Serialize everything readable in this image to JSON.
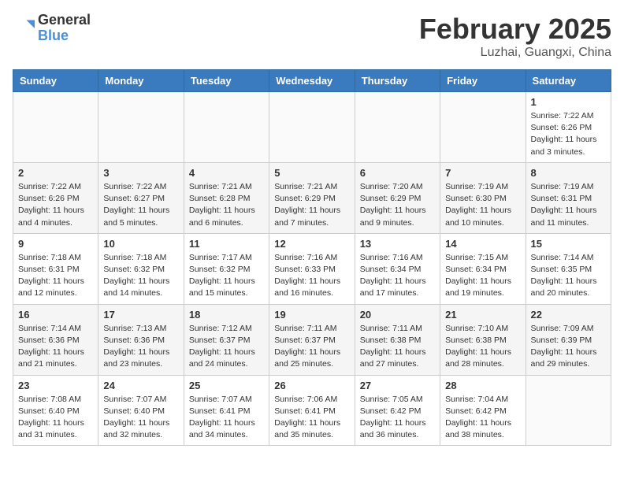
{
  "header": {
    "logo_general": "General",
    "logo_blue": "Blue",
    "month_title": "February 2025",
    "location": "Luzhai, Guangxi, China"
  },
  "weekdays": [
    "Sunday",
    "Monday",
    "Tuesday",
    "Wednesday",
    "Thursday",
    "Friday",
    "Saturday"
  ],
  "weeks": [
    [
      {
        "day": "",
        "info": ""
      },
      {
        "day": "",
        "info": ""
      },
      {
        "day": "",
        "info": ""
      },
      {
        "day": "",
        "info": ""
      },
      {
        "day": "",
        "info": ""
      },
      {
        "day": "",
        "info": ""
      },
      {
        "day": "1",
        "info": "Sunrise: 7:22 AM\nSunset: 6:26 PM\nDaylight: 11 hours\nand 3 minutes."
      }
    ],
    [
      {
        "day": "2",
        "info": "Sunrise: 7:22 AM\nSunset: 6:26 PM\nDaylight: 11 hours\nand 4 minutes."
      },
      {
        "day": "3",
        "info": "Sunrise: 7:22 AM\nSunset: 6:27 PM\nDaylight: 11 hours\nand 5 minutes."
      },
      {
        "day": "4",
        "info": "Sunrise: 7:21 AM\nSunset: 6:28 PM\nDaylight: 11 hours\nand 6 minutes."
      },
      {
        "day": "5",
        "info": "Sunrise: 7:21 AM\nSunset: 6:29 PM\nDaylight: 11 hours\nand 7 minutes."
      },
      {
        "day": "6",
        "info": "Sunrise: 7:20 AM\nSunset: 6:29 PM\nDaylight: 11 hours\nand 9 minutes."
      },
      {
        "day": "7",
        "info": "Sunrise: 7:19 AM\nSunset: 6:30 PM\nDaylight: 11 hours\nand 10 minutes."
      },
      {
        "day": "8",
        "info": "Sunrise: 7:19 AM\nSunset: 6:31 PM\nDaylight: 11 hours\nand 11 minutes."
      }
    ],
    [
      {
        "day": "9",
        "info": "Sunrise: 7:18 AM\nSunset: 6:31 PM\nDaylight: 11 hours\nand 12 minutes."
      },
      {
        "day": "10",
        "info": "Sunrise: 7:18 AM\nSunset: 6:32 PM\nDaylight: 11 hours\nand 14 minutes."
      },
      {
        "day": "11",
        "info": "Sunrise: 7:17 AM\nSunset: 6:32 PM\nDaylight: 11 hours\nand 15 minutes."
      },
      {
        "day": "12",
        "info": "Sunrise: 7:16 AM\nSunset: 6:33 PM\nDaylight: 11 hours\nand 16 minutes."
      },
      {
        "day": "13",
        "info": "Sunrise: 7:16 AM\nSunset: 6:34 PM\nDaylight: 11 hours\nand 17 minutes."
      },
      {
        "day": "14",
        "info": "Sunrise: 7:15 AM\nSunset: 6:34 PM\nDaylight: 11 hours\nand 19 minutes."
      },
      {
        "day": "15",
        "info": "Sunrise: 7:14 AM\nSunset: 6:35 PM\nDaylight: 11 hours\nand 20 minutes."
      }
    ],
    [
      {
        "day": "16",
        "info": "Sunrise: 7:14 AM\nSunset: 6:36 PM\nDaylight: 11 hours\nand 21 minutes."
      },
      {
        "day": "17",
        "info": "Sunrise: 7:13 AM\nSunset: 6:36 PM\nDaylight: 11 hours\nand 23 minutes."
      },
      {
        "day": "18",
        "info": "Sunrise: 7:12 AM\nSunset: 6:37 PM\nDaylight: 11 hours\nand 24 minutes."
      },
      {
        "day": "19",
        "info": "Sunrise: 7:11 AM\nSunset: 6:37 PM\nDaylight: 11 hours\nand 25 minutes."
      },
      {
        "day": "20",
        "info": "Sunrise: 7:11 AM\nSunset: 6:38 PM\nDaylight: 11 hours\nand 27 minutes."
      },
      {
        "day": "21",
        "info": "Sunrise: 7:10 AM\nSunset: 6:38 PM\nDaylight: 11 hours\nand 28 minutes."
      },
      {
        "day": "22",
        "info": "Sunrise: 7:09 AM\nSunset: 6:39 PM\nDaylight: 11 hours\nand 29 minutes."
      }
    ],
    [
      {
        "day": "23",
        "info": "Sunrise: 7:08 AM\nSunset: 6:40 PM\nDaylight: 11 hours\nand 31 minutes."
      },
      {
        "day": "24",
        "info": "Sunrise: 7:07 AM\nSunset: 6:40 PM\nDaylight: 11 hours\nand 32 minutes."
      },
      {
        "day": "25",
        "info": "Sunrise: 7:07 AM\nSunset: 6:41 PM\nDaylight: 11 hours\nand 34 minutes."
      },
      {
        "day": "26",
        "info": "Sunrise: 7:06 AM\nSunset: 6:41 PM\nDaylight: 11 hours\nand 35 minutes."
      },
      {
        "day": "27",
        "info": "Sunrise: 7:05 AM\nSunset: 6:42 PM\nDaylight: 11 hours\nand 36 minutes."
      },
      {
        "day": "28",
        "info": "Sunrise: 7:04 AM\nSunset: 6:42 PM\nDaylight: 11 hours\nand 38 minutes."
      },
      {
        "day": "",
        "info": ""
      }
    ]
  ]
}
